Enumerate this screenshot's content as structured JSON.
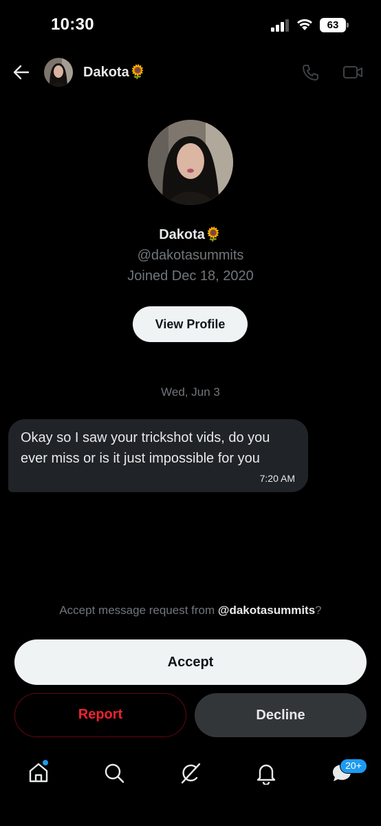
{
  "status_bar": {
    "time": "10:30",
    "battery": "63",
    "icons": [
      "signal-icon",
      "wifi-icon",
      "battery-icon"
    ]
  },
  "header": {
    "name": "Dakota🌻",
    "icons": [
      "back-arrow-icon",
      "avatar",
      "phone-icon",
      "video-call-icon"
    ]
  },
  "profile": {
    "name": "Dakota🌻",
    "handle": "@dakotasummits",
    "joined": "Joined Dec 18, 2020",
    "view_profile_label": "View Profile"
  },
  "conversation": {
    "date": "Wed, Jun 3",
    "messages": [
      {
        "text": "Okay so I saw your trickshot vids, do you ever miss or is it just impossible for you",
        "time": "7:20 AM"
      }
    ]
  },
  "request": {
    "prompt_prefix": "Accept message request from ",
    "prompt_handle": "@dakotasummits",
    "prompt_suffix": "?",
    "accept_label": "Accept",
    "report_label": "Report",
    "decline_label": "Decline"
  },
  "bottom_nav": {
    "items": [
      "home-icon",
      "search-icon",
      "grok-icon",
      "notifications-icon",
      "messages-icon"
    ],
    "messages_badge": "20+"
  },
  "colors": {
    "background": "#000000",
    "accent": "#1d9bf0",
    "danger": "#f4212e",
    "muted_text": "#71767b",
    "bubble": "#202327"
  }
}
